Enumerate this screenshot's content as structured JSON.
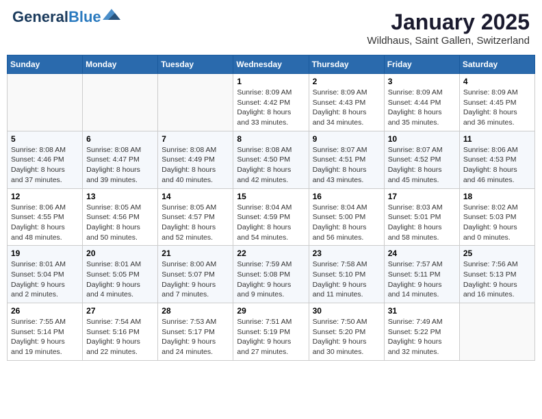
{
  "header": {
    "logo_line1": "General",
    "logo_line2": "Blue",
    "title": "January 2025",
    "subtitle": "Wildhaus, Saint Gallen, Switzerland"
  },
  "calendar": {
    "days_of_week": [
      "Sunday",
      "Monday",
      "Tuesday",
      "Wednesday",
      "Thursday",
      "Friday",
      "Saturday"
    ],
    "weeks": [
      [
        {
          "day": "",
          "sunrise": "",
          "sunset": "",
          "daylight": ""
        },
        {
          "day": "",
          "sunrise": "",
          "sunset": "",
          "daylight": ""
        },
        {
          "day": "",
          "sunrise": "",
          "sunset": "",
          "daylight": ""
        },
        {
          "day": "1",
          "sunrise": "8:09 AM",
          "sunset": "4:42 PM",
          "daylight": "8 hours and 33 minutes."
        },
        {
          "day": "2",
          "sunrise": "8:09 AM",
          "sunset": "4:43 PM",
          "daylight": "8 hours and 34 minutes."
        },
        {
          "day": "3",
          "sunrise": "8:09 AM",
          "sunset": "4:44 PM",
          "daylight": "8 hours and 35 minutes."
        },
        {
          "day": "4",
          "sunrise": "8:09 AM",
          "sunset": "4:45 PM",
          "daylight": "8 hours and 36 minutes."
        }
      ],
      [
        {
          "day": "5",
          "sunrise": "8:08 AM",
          "sunset": "4:46 PM",
          "daylight": "8 hours and 37 minutes."
        },
        {
          "day": "6",
          "sunrise": "8:08 AM",
          "sunset": "4:47 PM",
          "daylight": "8 hours and 39 minutes."
        },
        {
          "day": "7",
          "sunrise": "8:08 AM",
          "sunset": "4:49 PM",
          "daylight": "8 hours and 40 minutes."
        },
        {
          "day": "8",
          "sunrise": "8:08 AM",
          "sunset": "4:50 PM",
          "daylight": "8 hours and 42 minutes."
        },
        {
          "day": "9",
          "sunrise": "8:07 AM",
          "sunset": "4:51 PM",
          "daylight": "8 hours and 43 minutes."
        },
        {
          "day": "10",
          "sunrise": "8:07 AM",
          "sunset": "4:52 PM",
          "daylight": "8 hours and 45 minutes."
        },
        {
          "day": "11",
          "sunrise": "8:06 AM",
          "sunset": "4:53 PM",
          "daylight": "8 hours and 46 minutes."
        }
      ],
      [
        {
          "day": "12",
          "sunrise": "8:06 AM",
          "sunset": "4:55 PM",
          "daylight": "8 hours and 48 minutes."
        },
        {
          "day": "13",
          "sunrise": "8:05 AM",
          "sunset": "4:56 PM",
          "daylight": "8 hours and 50 minutes."
        },
        {
          "day": "14",
          "sunrise": "8:05 AM",
          "sunset": "4:57 PM",
          "daylight": "8 hours and 52 minutes."
        },
        {
          "day": "15",
          "sunrise": "8:04 AM",
          "sunset": "4:59 PM",
          "daylight": "8 hours and 54 minutes."
        },
        {
          "day": "16",
          "sunrise": "8:04 AM",
          "sunset": "5:00 PM",
          "daylight": "8 hours and 56 minutes."
        },
        {
          "day": "17",
          "sunrise": "8:03 AM",
          "sunset": "5:01 PM",
          "daylight": "8 hours and 58 minutes."
        },
        {
          "day": "18",
          "sunrise": "8:02 AM",
          "sunset": "5:03 PM",
          "daylight": "9 hours and 0 minutes."
        }
      ],
      [
        {
          "day": "19",
          "sunrise": "8:01 AM",
          "sunset": "5:04 PM",
          "daylight": "9 hours and 2 minutes."
        },
        {
          "day": "20",
          "sunrise": "8:01 AM",
          "sunset": "5:05 PM",
          "daylight": "9 hours and 4 minutes."
        },
        {
          "day": "21",
          "sunrise": "8:00 AM",
          "sunset": "5:07 PM",
          "daylight": "9 hours and 7 minutes."
        },
        {
          "day": "22",
          "sunrise": "7:59 AM",
          "sunset": "5:08 PM",
          "daylight": "9 hours and 9 minutes."
        },
        {
          "day": "23",
          "sunrise": "7:58 AM",
          "sunset": "5:10 PM",
          "daylight": "9 hours and 11 minutes."
        },
        {
          "day": "24",
          "sunrise": "7:57 AM",
          "sunset": "5:11 PM",
          "daylight": "9 hours and 14 minutes."
        },
        {
          "day": "25",
          "sunrise": "7:56 AM",
          "sunset": "5:13 PM",
          "daylight": "9 hours and 16 minutes."
        }
      ],
      [
        {
          "day": "26",
          "sunrise": "7:55 AM",
          "sunset": "5:14 PM",
          "daylight": "9 hours and 19 minutes."
        },
        {
          "day": "27",
          "sunrise": "7:54 AM",
          "sunset": "5:16 PM",
          "daylight": "9 hours and 22 minutes."
        },
        {
          "day": "28",
          "sunrise": "7:53 AM",
          "sunset": "5:17 PM",
          "daylight": "9 hours and 24 minutes."
        },
        {
          "day": "29",
          "sunrise": "7:51 AM",
          "sunset": "5:19 PM",
          "daylight": "9 hours and 27 minutes."
        },
        {
          "day": "30",
          "sunrise": "7:50 AM",
          "sunset": "5:20 PM",
          "daylight": "9 hours and 30 minutes."
        },
        {
          "day": "31",
          "sunrise": "7:49 AM",
          "sunset": "5:22 PM",
          "daylight": "9 hours and 32 minutes."
        },
        {
          "day": "",
          "sunrise": "",
          "sunset": "",
          "daylight": ""
        }
      ]
    ]
  }
}
